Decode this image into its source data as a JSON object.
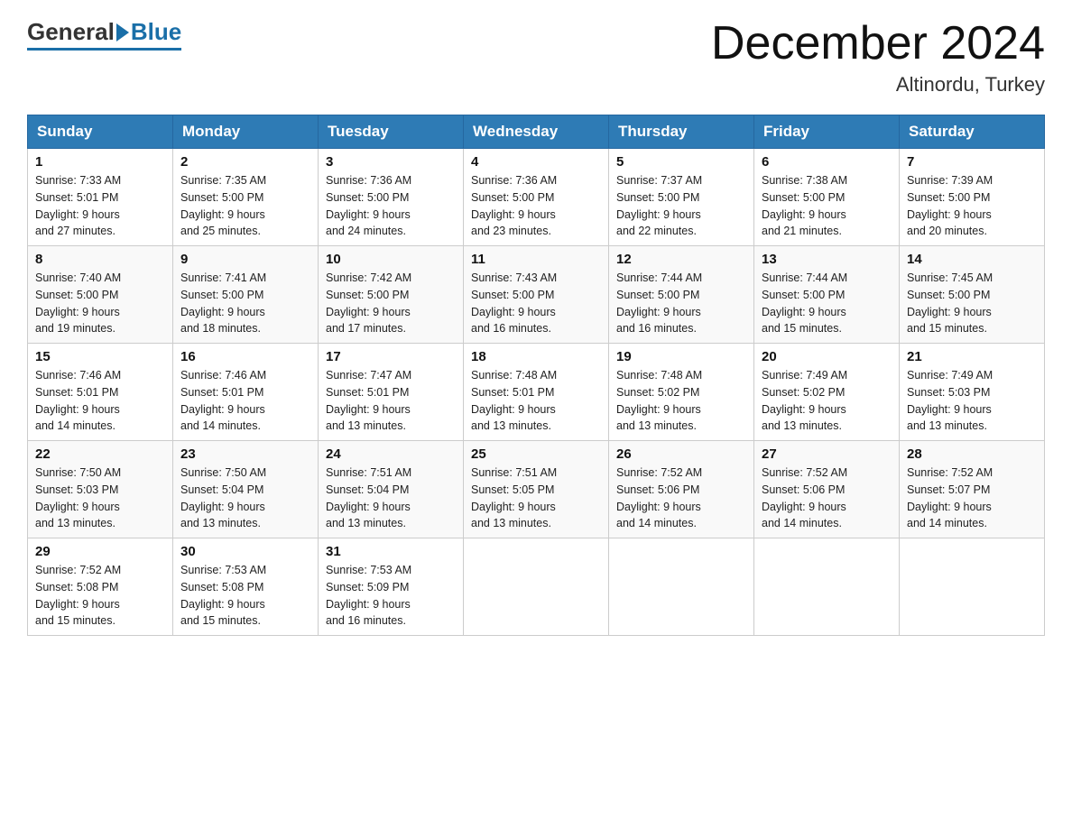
{
  "logo": {
    "text_general": "General",
    "text_blue": "Blue",
    "arrow_char": "▶"
  },
  "header": {
    "title": "December 2024",
    "subtitle": "Altinordu, Turkey"
  },
  "days_of_week": [
    "Sunday",
    "Monday",
    "Tuesday",
    "Wednesday",
    "Thursday",
    "Friday",
    "Saturday"
  ],
  "weeks": [
    [
      {
        "day": "1",
        "sunrise": "Sunrise: 7:33 AM",
        "sunset": "Sunset: 5:01 PM",
        "daylight": "Daylight: 9 hours",
        "daylight2": "and 27 minutes."
      },
      {
        "day": "2",
        "sunrise": "Sunrise: 7:35 AM",
        "sunset": "Sunset: 5:00 PM",
        "daylight": "Daylight: 9 hours",
        "daylight2": "and 25 minutes."
      },
      {
        "day": "3",
        "sunrise": "Sunrise: 7:36 AM",
        "sunset": "Sunset: 5:00 PM",
        "daylight": "Daylight: 9 hours",
        "daylight2": "and 24 minutes."
      },
      {
        "day": "4",
        "sunrise": "Sunrise: 7:36 AM",
        "sunset": "Sunset: 5:00 PM",
        "daylight": "Daylight: 9 hours",
        "daylight2": "and 23 minutes."
      },
      {
        "day": "5",
        "sunrise": "Sunrise: 7:37 AM",
        "sunset": "Sunset: 5:00 PM",
        "daylight": "Daylight: 9 hours",
        "daylight2": "and 22 minutes."
      },
      {
        "day": "6",
        "sunrise": "Sunrise: 7:38 AM",
        "sunset": "Sunset: 5:00 PM",
        "daylight": "Daylight: 9 hours",
        "daylight2": "and 21 minutes."
      },
      {
        "day": "7",
        "sunrise": "Sunrise: 7:39 AM",
        "sunset": "Sunset: 5:00 PM",
        "daylight": "Daylight: 9 hours",
        "daylight2": "and 20 minutes."
      }
    ],
    [
      {
        "day": "8",
        "sunrise": "Sunrise: 7:40 AM",
        "sunset": "Sunset: 5:00 PM",
        "daylight": "Daylight: 9 hours",
        "daylight2": "and 19 minutes."
      },
      {
        "day": "9",
        "sunrise": "Sunrise: 7:41 AM",
        "sunset": "Sunset: 5:00 PM",
        "daylight": "Daylight: 9 hours",
        "daylight2": "and 18 minutes."
      },
      {
        "day": "10",
        "sunrise": "Sunrise: 7:42 AM",
        "sunset": "Sunset: 5:00 PM",
        "daylight": "Daylight: 9 hours",
        "daylight2": "and 17 minutes."
      },
      {
        "day": "11",
        "sunrise": "Sunrise: 7:43 AM",
        "sunset": "Sunset: 5:00 PM",
        "daylight": "Daylight: 9 hours",
        "daylight2": "and 16 minutes."
      },
      {
        "day": "12",
        "sunrise": "Sunrise: 7:44 AM",
        "sunset": "Sunset: 5:00 PM",
        "daylight": "Daylight: 9 hours",
        "daylight2": "and 16 minutes."
      },
      {
        "day": "13",
        "sunrise": "Sunrise: 7:44 AM",
        "sunset": "Sunset: 5:00 PM",
        "daylight": "Daylight: 9 hours",
        "daylight2": "and 15 minutes."
      },
      {
        "day": "14",
        "sunrise": "Sunrise: 7:45 AM",
        "sunset": "Sunset: 5:00 PM",
        "daylight": "Daylight: 9 hours",
        "daylight2": "and 15 minutes."
      }
    ],
    [
      {
        "day": "15",
        "sunrise": "Sunrise: 7:46 AM",
        "sunset": "Sunset: 5:01 PM",
        "daylight": "Daylight: 9 hours",
        "daylight2": "and 14 minutes."
      },
      {
        "day": "16",
        "sunrise": "Sunrise: 7:46 AM",
        "sunset": "Sunset: 5:01 PM",
        "daylight": "Daylight: 9 hours",
        "daylight2": "and 14 minutes."
      },
      {
        "day": "17",
        "sunrise": "Sunrise: 7:47 AM",
        "sunset": "Sunset: 5:01 PM",
        "daylight": "Daylight: 9 hours",
        "daylight2": "and 13 minutes."
      },
      {
        "day": "18",
        "sunrise": "Sunrise: 7:48 AM",
        "sunset": "Sunset: 5:01 PM",
        "daylight": "Daylight: 9 hours",
        "daylight2": "and 13 minutes."
      },
      {
        "day": "19",
        "sunrise": "Sunrise: 7:48 AM",
        "sunset": "Sunset: 5:02 PM",
        "daylight": "Daylight: 9 hours",
        "daylight2": "and 13 minutes."
      },
      {
        "day": "20",
        "sunrise": "Sunrise: 7:49 AM",
        "sunset": "Sunset: 5:02 PM",
        "daylight": "Daylight: 9 hours",
        "daylight2": "and 13 minutes."
      },
      {
        "day": "21",
        "sunrise": "Sunrise: 7:49 AM",
        "sunset": "Sunset: 5:03 PM",
        "daylight": "Daylight: 9 hours",
        "daylight2": "and 13 minutes."
      }
    ],
    [
      {
        "day": "22",
        "sunrise": "Sunrise: 7:50 AM",
        "sunset": "Sunset: 5:03 PM",
        "daylight": "Daylight: 9 hours",
        "daylight2": "and 13 minutes."
      },
      {
        "day": "23",
        "sunrise": "Sunrise: 7:50 AM",
        "sunset": "Sunset: 5:04 PM",
        "daylight": "Daylight: 9 hours",
        "daylight2": "and 13 minutes."
      },
      {
        "day": "24",
        "sunrise": "Sunrise: 7:51 AM",
        "sunset": "Sunset: 5:04 PM",
        "daylight": "Daylight: 9 hours",
        "daylight2": "and 13 minutes."
      },
      {
        "day": "25",
        "sunrise": "Sunrise: 7:51 AM",
        "sunset": "Sunset: 5:05 PM",
        "daylight": "Daylight: 9 hours",
        "daylight2": "and 13 minutes."
      },
      {
        "day": "26",
        "sunrise": "Sunrise: 7:52 AM",
        "sunset": "Sunset: 5:06 PM",
        "daylight": "Daylight: 9 hours",
        "daylight2": "and 14 minutes."
      },
      {
        "day": "27",
        "sunrise": "Sunrise: 7:52 AM",
        "sunset": "Sunset: 5:06 PM",
        "daylight": "Daylight: 9 hours",
        "daylight2": "and 14 minutes."
      },
      {
        "day": "28",
        "sunrise": "Sunrise: 7:52 AM",
        "sunset": "Sunset: 5:07 PM",
        "daylight": "Daylight: 9 hours",
        "daylight2": "and 14 minutes."
      }
    ],
    [
      {
        "day": "29",
        "sunrise": "Sunrise: 7:52 AM",
        "sunset": "Sunset: 5:08 PM",
        "daylight": "Daylight: 9 hours",
        "daylight2": "and 15 minutes."
      },
      {
        "day": "30",
        "sunrise": "Sunrise: 7:53 AM",
        "sunset": "Sunset: 5:08 PM",
        "daylight": "Daylight: 9 hours",
        "daylight2": "and 15 minutes."
      },
      {
        "day": "31",
        "sunrise": "Sunrise: 7:53 AM",
        "sunset": "Sunset: 5:09 PM",
        "daylight": "Daylight: 9 hours",
        "daylight2": "and 16 minutes."
      },
      null,
      null,
      null,
      null
    ]
  ]
}
